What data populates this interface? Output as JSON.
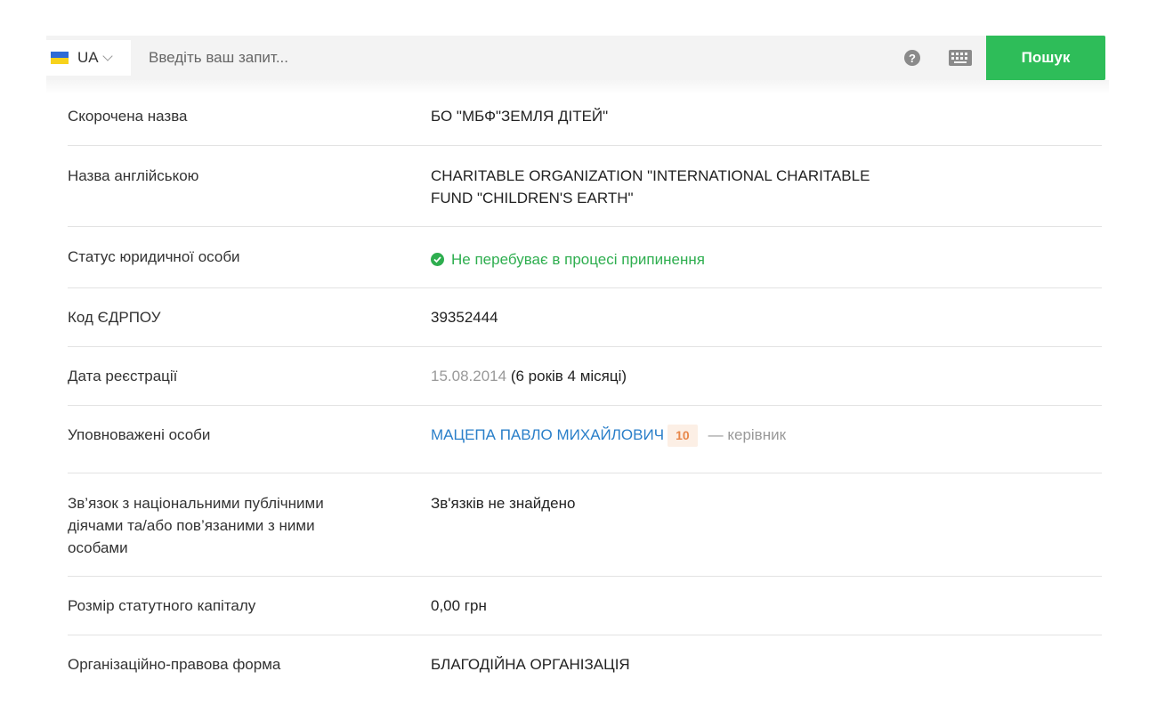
{
  "search": {
    "lang_code": "UA",
    "placeholder": "Введіть ваш запит...",
    "help_icon": "question-circle-icon",
    "keyboard_icon": "keyboard-icon",
    "button_label": "Пошук"
  },
  "colors": {
    "accent_green": "#2ebd59",
    "status_green": "#2eae4f",
    "link_blue": "#2a7fc9",
    "badge_orange": "#e8874a"
  },
  "rows": {
    "short_name": {
      "label": "Скорочена назва",
      "value": "БО \"МБФ\"ЗЕМЛЯ ДІТЕЙ\""
    },
    "english_name": {
      "label": "Назва англійською",
      "value": "CHARITABLE ORGANIZATION \"INTERNATIONAL CHARITABLE FUND \"CHILDREN'S EARTH\""
    },
    "status": {
      "label": "Статус юридичної особи",
      "value": "Не перебуває в процесі припинення"
    },
    "edrpou": {
      "label": "Код ЄДРПОУ",
      "value": "39352444"
    },
    "reg_date": {
      "label": "Дата реєстрації",
      "date": "15.08.2014",
      "duration": "(6 років 4 місяці)"
    },
    "authorized": {
      "label": "Уповноважені особи",
      "person": "МАЦЕПА ПАВЛО МИХАЙЛОВИЧ",
      "badge": "10",
      "role": "— керівник"
    },
    "pep": {
      "label": "Зв’язок з національними публічними діячами та/або пов’язаними з ними особами",
      "value": "Зв'язків не знайдено"
    },
    "capital": {
      "label": "Розмір статутного капіталу",
      "value": "0,00 грн"
    },
    "legal_form": {
      "label": "Організаційно-правова форма",
      "value": "БЛАГОДІЙНА ОРГАНІЗАЦІЯ"
    }
  }
}
